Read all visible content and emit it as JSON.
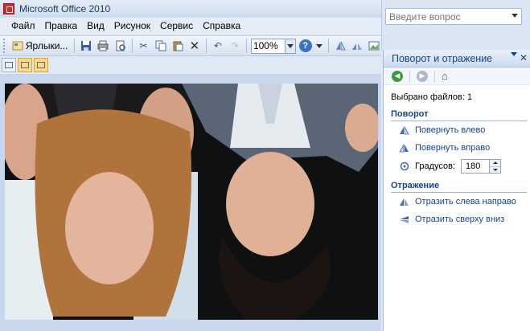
{
  "window": {
    "title": "Microsoft Office 2010"
  },
  "menu": [
    "Файл",
    "Правка",
    "Вид",
    "Рисунок",
    "Сервис",
    "Справка"
  ],
  "ask": {
    "placeholder": "Введите вопрос"
  },
  "toolbar": {
    "shortcuts_label": "Ярлыки...",
    "zoom_value": "100%"
  },
  "pane": {
    "title": "Поворот и отражение",
    "files_selected": "Выбрано файлов: 1",
    "rotation_heading": "Поворот",
    "rotate_left": "Повернуть влево",
    "rotate_right": "Повернуть вправо",
    "degrees_label": "Градусов:",
    "degrees_value": "180",
    "flip_heading": "Отражение",
    "flip_horizontal": "Отразить слева направо",
    "flip_vertical": "Отразить сверху вниз"
  },
  "colors": {
    "accent": "#15428b",
    "chrome": "#dfe9f5",
    "selected": "#fbd980"
  },
  "icons": [
    "office-app-icon",
    "save-icon",
    "print-icon",
    "cut-icon",
    "copy-icon",
    "paste-icon",
    "delete-icon",
    "undo-icon",
    "redo-icon",
    "help-icon",
    "back-icon",
    "forward-icon",
    "home-icon",
    "rotate-left-icon",
    "rotate-right-icon",
    "degrees-icon",
    "flip-horizontal-icon",
    "flip-vertical-icon"
  ]
}
